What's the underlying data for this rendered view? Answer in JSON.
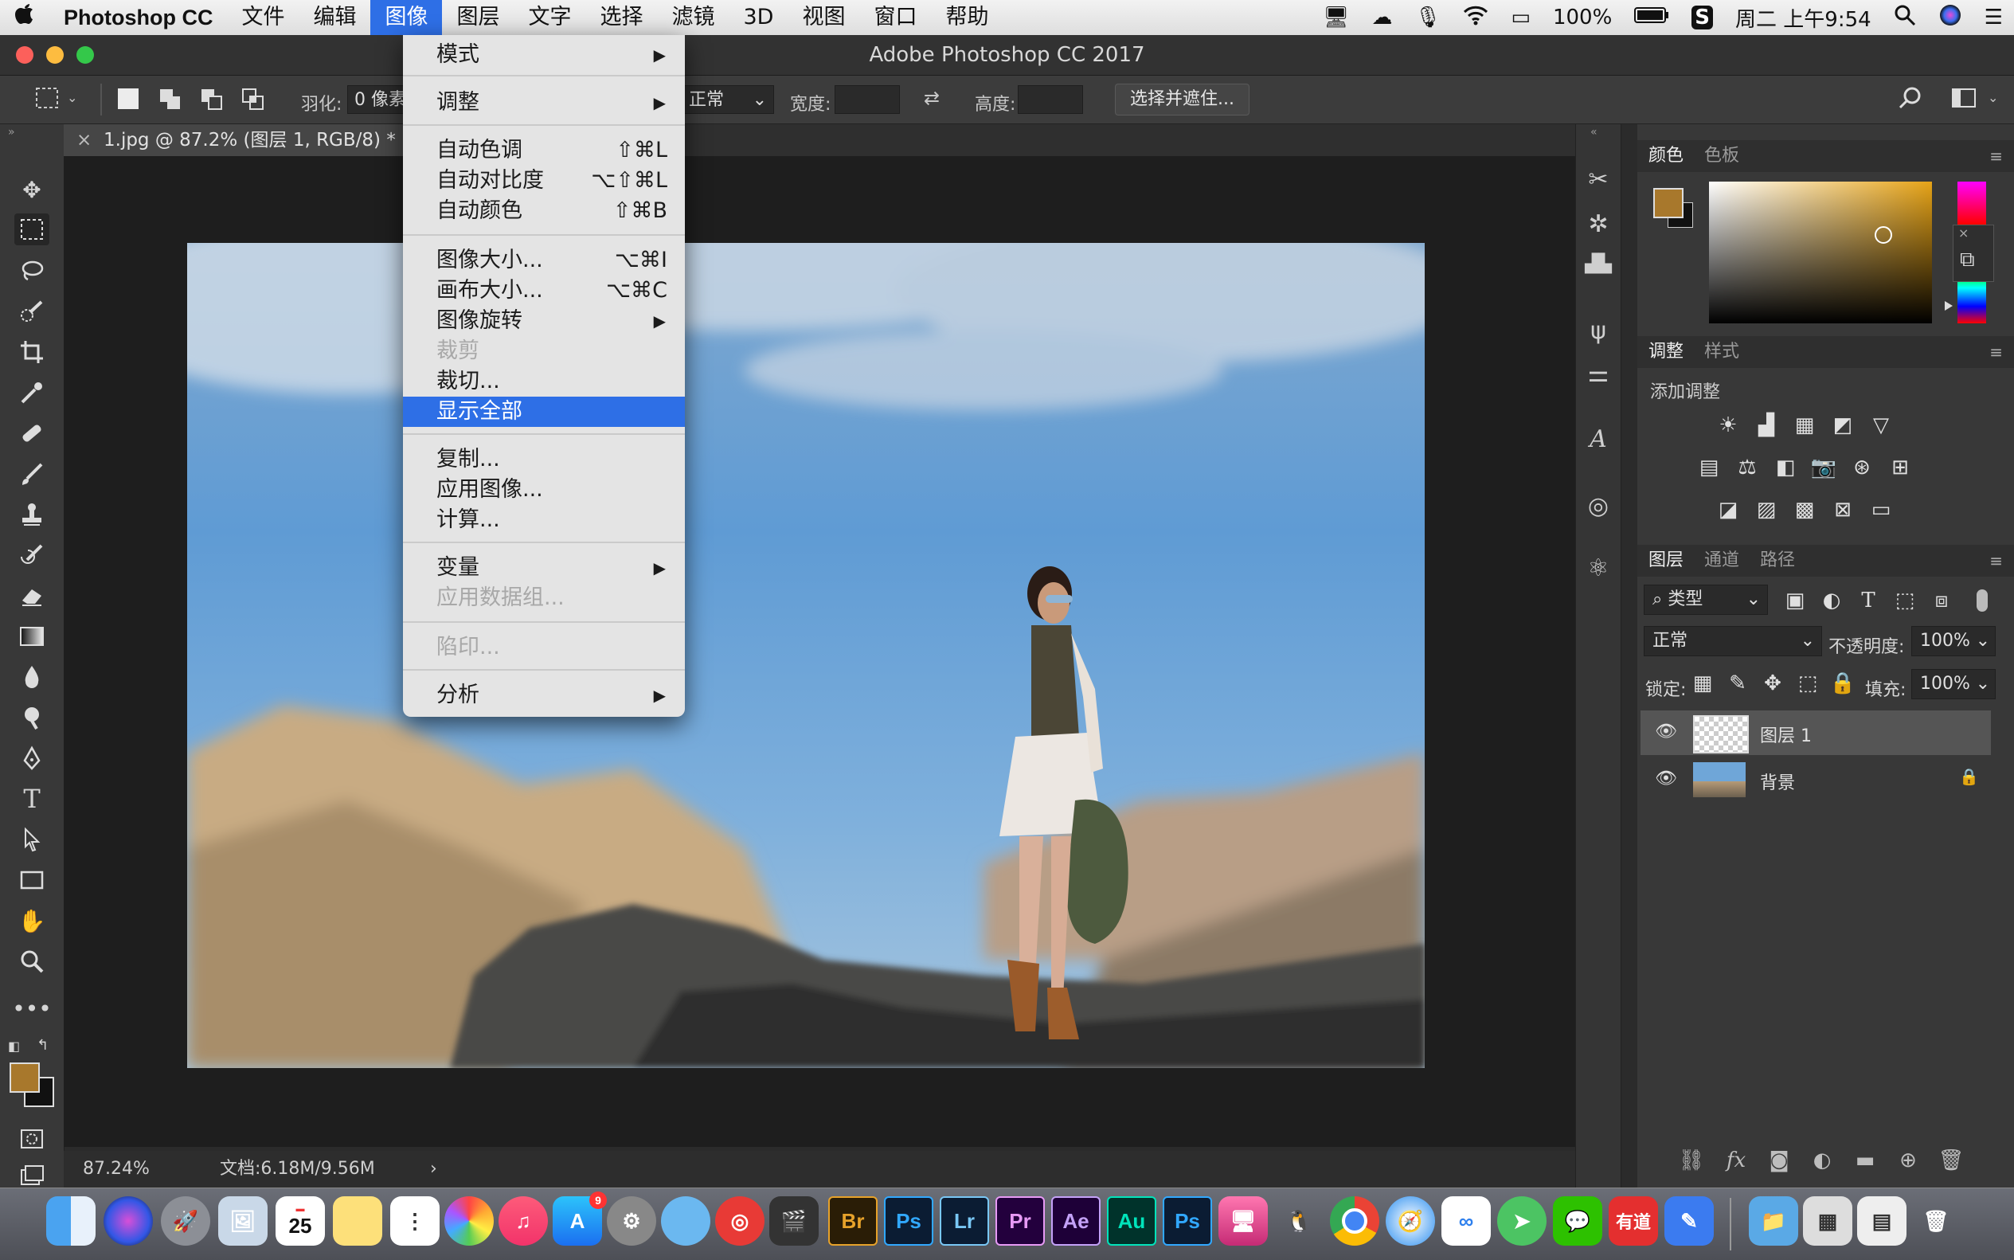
{
  "menubar": {
    "apple": "",
    "app_name": "Photoshop CC",
    "items": [
      "文件",
      "编辑",
      "图像",
      "图层",
      "文字",
      "选择",
      "滤镜",
      "3D",
      "视图",
      "窗口",
      "帮助"
    ],
    "battery": "100%",
    "clock": "周二 上午9:54"
  },
  "window": {
    "title": "Adobe Photoshop CC 2017"
  },
  "options": {
    "feather_label": "羽化:",
    "feather_value": "0 像素",
    "style_value": "正常",
    "width_label": "宽度:",
    "height_label": "高度:",
    "select_mask_button": "选择并遮住..."
  },
  "document": {
    "tab_title": "1.jpg @ 87.2% (图层 1, RGB/8) *",
    "close": "×",
    "zoom": "87.24%",
    "doc_info": "文档:6.18M/9.56M",
    "status_arrow": "›"
  },
  "image_menu": {
    "items": [
      {
        "label": "模式",
        "submenu": true
      },
      {
        "label": "调整",
        "submenu": true
      },
      {
        "label": "自动色调",
        "shortcut": "⇧⌘L"
      },
      {
        "label": "自动对比度",
        "shortcut": "⌥⇧⌘L"
      },
      {
        "label": "自动颜色",
        "shortcut": "⇧⌘B"
      },
      {
        "label": "图像大小...",
        "shortcut": "⌥⌘I"
      },
      {
        "label": "画布大小...",
        "shortcut": "⌥⌘C"
      },
      {
        "label": "图像旋转",
        "submenu": true
      },
      {
        "label": "裁剪",
        "disabled": true
      },
      {
        "label": "裁切..."
      },
      {
        "label": "显示全部",
        "highlighted": true
      },
      {
        "label": "复制..."
      },
      {
        "label": "应用图像..."
      },
      {
        "label": "计算..."
      },
      {
        "label": "变量",
        "submenu": true
      },
      {
        "label": "应用数据组...",
        "disabled": true
      },
      {
        "label": "陷印...",
        "disabled": true
      },
      {
        "label": "分析",
        "submenu": true
      }
    ],
    "arrow": "▶"
  },
  "color_panel": {
    "tabs": [
      "颜色",
      "色板"
    ],
    "foreground": "#a8782c",
    "background": "#111111"
  },
  "adjust_panel": {
    "tabs": [
      "调整",
      "样式"
    ],
    "add_label": "添加调整"
  },
  "layers_panel": {
    "tabs": [
      "图层",
      "通道",
      "路径"
    ],
    "filter": "类型",
    "blend_mode": "正常",
    "opacity_label": "不透明度:",
    "opacity_value": "100%",
    "lock_label": "锁定:",
    "fill_label": "填充:",
    "fill_value": "100%",
    "layers": [
      {
        "name": "图层 1",
        "selected": true
      },
      {
        "name": "背景",
        "locked": true
      }
    ]
  },
  "dock": {
    "calendar_day": "25",
    "appstore_badge": "9",
    "adobe_apps": [
      "Br",
      "Ps",
      "Lr",
      "Pr",
      "Ae",
      "Au",
      "Ps"
    ],
    "youdao": "有道"
  }
}
